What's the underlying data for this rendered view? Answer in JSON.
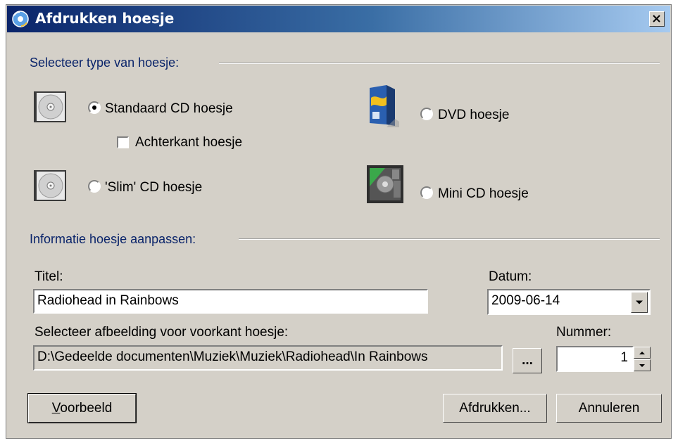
{
  "window": {
    "title": "Afdrukken hoesje",
    "close_symbol": "×"
  },
  "type_group": {
    "label": "Selecteer type van hoesje:",
    "options": [
      {
        "label": "Standaard CD hoesje",
        "selected": true,
        "icon": "cd-case-icon"
      },
      {
        "label": "'Slim' CD hoesje",
        "selected": false,
        "icon": "slim-cd-case-icon"
      },
      {
        "label": "DVD hoesje",
        "selected": false,
        "icon": "dvd-case-icon"
      },
      {
        "label": "Mini CD hoesje",
        "selected": false,
        "icon": "mini-cd-case-icon"
      }
    ],
    "back_cover": {
      "label": "Achterkant hoesje",
      "checked": false
    }
  },
  "info_group": {
    "label": "Informatie hoesje aanpassen:",
    "title_label": "Titel:",
    "title_value": "Radiohead in Rainbows",
    "date_label": "Datum:",
    "date_value": "2009-06-14",
    "image_label": "Selecteer afbeelding voor voorkant hoesje:",
    "image_path": "D:\\Gedeelde documenten\\Muziek\\Muziek\\Radiohead\\In Rainbows",
    "browse_label": "...",
    "number_label": "Nummer:",
    "number_value": "1"
  },
  "buttons": {
    "preview_mnemonic": "V",
    "preview_rest": "oorbeeld",
    "print": "Afdrukken...",
    "cancel": "Annuleren"
  },
  "colors": {
    "titlebar_start": "#0a246a",
    "titlebar_end": "#a6caf0",
    "group_label": "#0a246a",
    "dialog_bg": "#d4d0c8"
  }
}
